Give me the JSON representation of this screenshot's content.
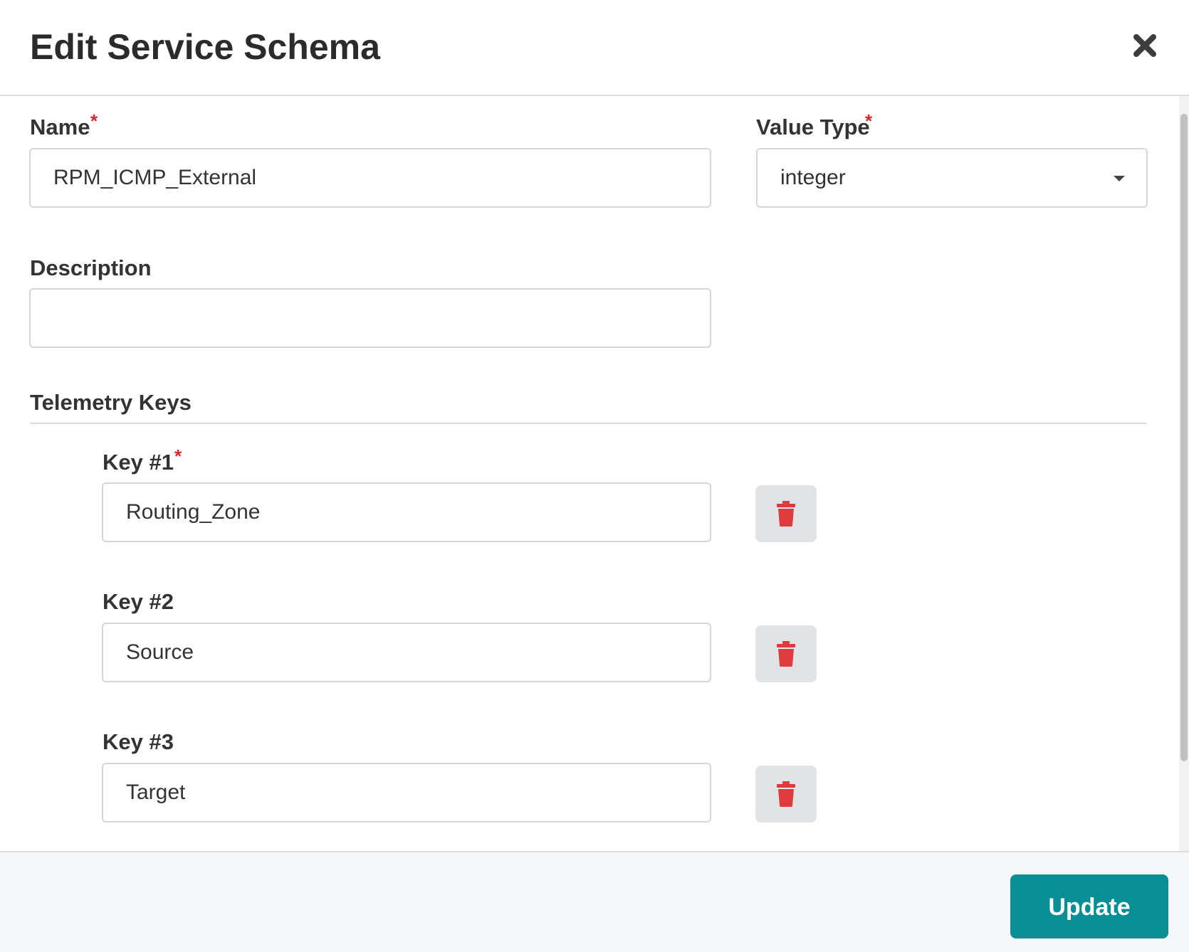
{
  "dialog": {
    "title": "Edit Service Schema"
  },
  "form": {
    "name": {
      "label": "Name",
      "required_marker": "*",
      "value": "RPM_ICMP_External"
    },
    "value_type": {
      "label": "Value Type",
      "required_marker": "*",
      "selected": "integer"
    },
    "description": {
      "label": "Description",
      "value": ""
    }
  },
  "telemetry": {
    "section_title": "Telemetry Keys",
    "keys": [
      {
        "label": "Key #1",
        "required_marker": "*",
        "value": "Routing_Zone"
      },
      {
        "label": "Key #2",
        "required_marker": "",
        "value": "Source"
      },
      {
        "label": "Key #3",
        "required_marker": "",
        "value": "Target"
      }
    ]
  },
  "footer": {
    "update_label": "Update"
  },
  "colors": {
    "accent": "#088f96",
    "required": "#d9262c",
    "delete_icon": "#e03a3e",
    "button_gray": "#e2e3e5"
  },
  "icons": {
    "close": "close-icon",
    "dropdown": "chevron-down-icon",
    "delete": "trash-icon"
  }
}
